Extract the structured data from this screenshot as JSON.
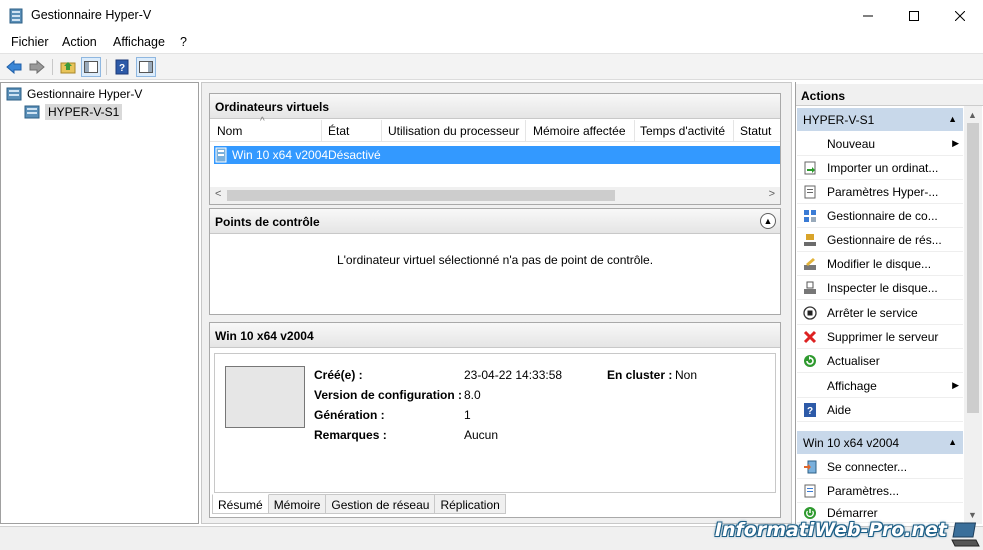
{
  "window": {
    "title": "Gestionnaire Hyper-V"
  },
  "menu": [
    "Fichier",
    "Action",
    "Affichage",
    "?"
  ],
  "tree": {
    "root": "Gestionnaire Hyper-V",
    "child": "HYPER-V-S1"
  },
  "vms": {
    "title": "Ordinateurs virtuels",
    "columns": [
      "Nom",
      "État",
      "Utilisation du processeur",
      "Mémoire affectée",
      "Temps d'activité",
      "Statut"
    ],
    "rows": [
      {
        "name": "Win 10 x64 v2004",
        "state": "Désactivé"
      }
    ]
  },
  "checkpoints": {
    "title": "Points de contrôle",
    "message": "L'ordinateur virtuel sélectionné n'a pas de point de contrôle."
  },
  "details": {
    "title": "Win 10 x64 v2004",
    "created_label": "Créé(e) :",
    "created_value": "23-04-22 14:33:58",
    "cluster_label": "En cluster :",
    "cluster_value": "Non",
    "config_label": "Version de configuration :",
    "config_value": "8.0",
    "gen_label": "Génération :",
    "gen_value": "1",
    "notes_label": "Remarques :",
    "notes_value": "Aucun",
    "tabs": [
      "Résumé",
      "Mémoire",
      "Gestion de réseau",
      "Réplication"
    ]
  },
  "actions": {
    "title": "Actions",
    "group1": "HYPER-V-S1",
    "items1": [
      "Nouveau",
      "Importer un ordinat...",
      "Paramètres Hyper-...",
      "Gestionnaire de co...",
      "Gestionnaire de rés...",
      "Modifier le disque...",
      "Inspecter le disque...",
      "Arrêter le service",
      "Supprimer le serveur",
      "Actualiser",
      "Affichage",
      "Aide"
    ],
    "group2": "Win 10 x64 v2004",
    "items2": [
      "Se connecter...",
      "Paramètres...",
      "Démarrer"
    ]
  },
  "watermark": "InformatiWeb-Pro.net",
  "colors": {
    "selection": "#3399ff",
    "group_header": "#c8d8ea"
  }
}
